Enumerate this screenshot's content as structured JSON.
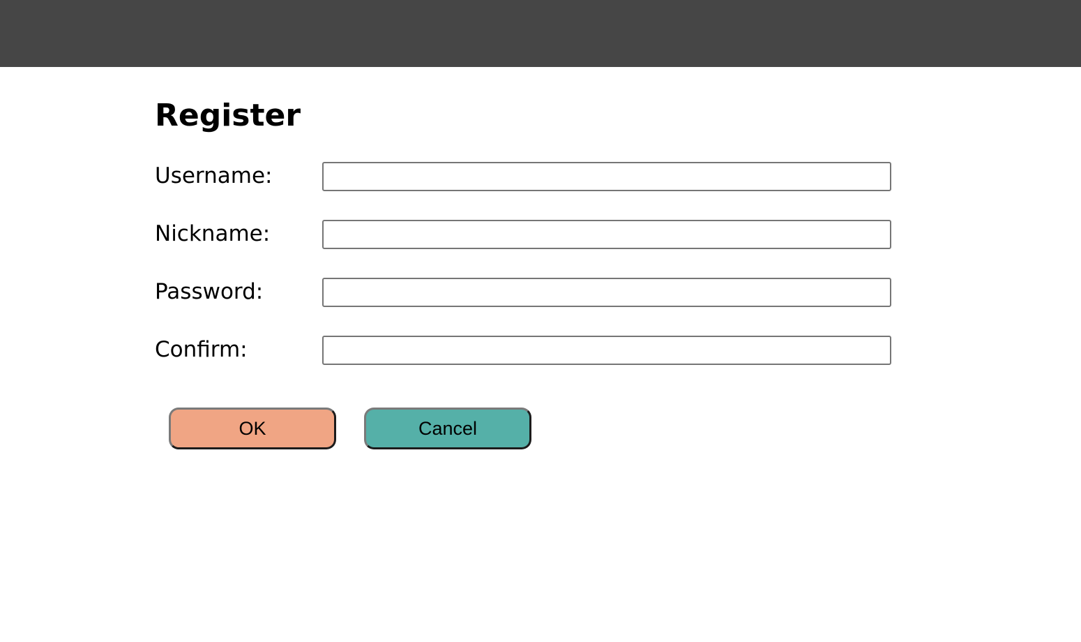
{
  "header": {
    "background": "#464646"
  },
  "form": {
    "title": "Register",
    "fields": [
      {
        "label": "Username:",
        "value": "",
        "placeholder": ""
      },
      {
        "label": "Nickname:",
        "value": "",
        "placeholder": ""
      },
      {
        "label": "Password:",
        "value": "",
        "placeholder": ""
      },
      {
        "label": "Confirm:",
        "value": "",
        "placeholder": ""
      }
    ],
    "buttons": {
      "ok_label": "OK",
      "ok_color": "#f0a584",
      "cancel_label": "Cancel",
      "cancel_color": "#55b0a8"
    }
  }
}
